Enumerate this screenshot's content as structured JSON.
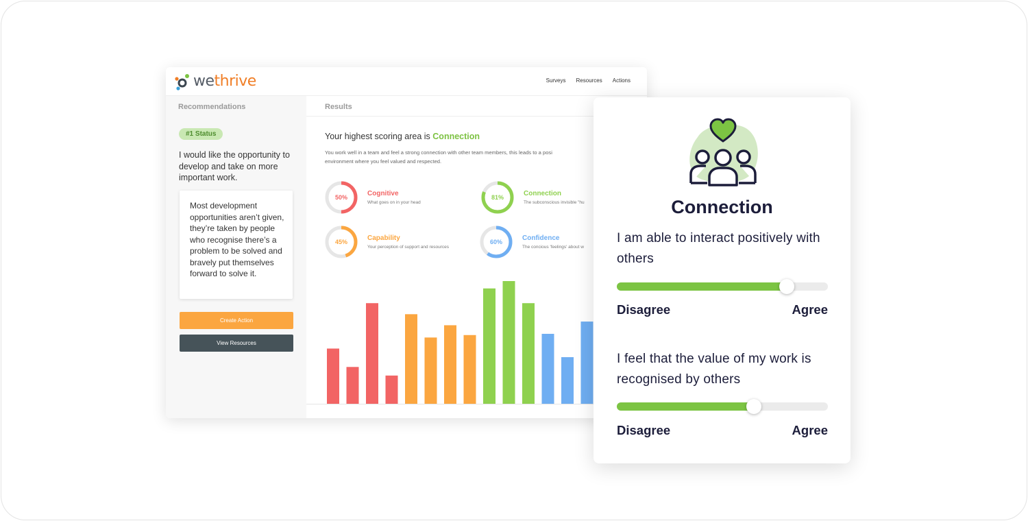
{
  "app": {
    "logo_we": "we",
    "logo_thrive": "thrive",
    "nav": [
      "Surveys",
      "Resources",
      "Actions"
    ]
  },
  "sidebar": {
    "title": "Recommendations",
    "status_badge": "#1 Status",
    "recommendation": "I would like the opportunity to develop and take on more important work.",
    "quote": "Most development opportunities aren’t given, they’re taken by people who recognise there’s a problem to be solved and bravely put themselves forward to solve it.",
    "create_action_label": "Create Action",
    "view_resources_label": "View Resources"
  },
  "results": {
    "title": "Results",
    "highest_prefix": "Your highest scoring area is ",
    "highest_area": "Connection",
    "description_line1": "You work well in a team and feel a strong connection with other team members, this leads to a posi",
    "description_line2": "environment where you feel valued and respected.",
    "metrics": [
      {
        "name": "Cognitive",
        "percent_label": "50%",
        "value": 50,
        "description": "What goes on in your head",
        "color": "#f26464"
      },
      {
        "name": "Connection",
        "percent_label": "81%",
        "value": 81,
        "description": "The subconscious invisible \"hu",
        "color": "#8fd14f"
      },
      {
        "name": "Capability",
        "percent_label": "45%",
        "value": 45,
        "description": "Your perception of support and resources",
        "color": "#fba640"
      },
      {
        "name": "Confidence",
        "percent_label": "60%",
        "value": 60,
        "description": "The concious 'feelings' about w",
        "color": "#6faef2"
      }
    ],
    "ring_track_color": "#e6e6e6"
  },
  "chart_data": {
    "type": "bar",
    "title": "",
    "xlabel": "",
    "ylabel": "",
    "ylim": [
      0,
      100
    ],
    "values": [
      45,
      30,
      82,
      23,
      73,
      54,
      64,
      56,
      94,
      100,
      82,
      57,
      38,
      67
    ],
    "colors": [
      "#f26464",
      "#f26464",
      "#f26464",
      "#f26464",
      "#fba640",
      "#fba640",
      "#fba640",
      "#fba640",
      "#8fd14f",
      "#8fd14f",
      "#8fd14f",
      "#6faef2",
      "#6faef2",
      "#6faef2"
    ]
  },
  "card": {
    "icon": "people-heart-icon",
    "title": "Connection",
    "questions": [
      {
        "text": "I am able to interact positively with others",
        "value": 0.805,
        "low": "Disagree",
        "high": "Agree"
      },
      {
        "text": "I feel that the value of my work is recognised by others",
        "value": 0.65,
        "low": "Disagree",
        "high": "Agree"
      }
    ],
    "accent_color": "#7cc443",
    "blob_color": "#d3e9c4"
  }
}
